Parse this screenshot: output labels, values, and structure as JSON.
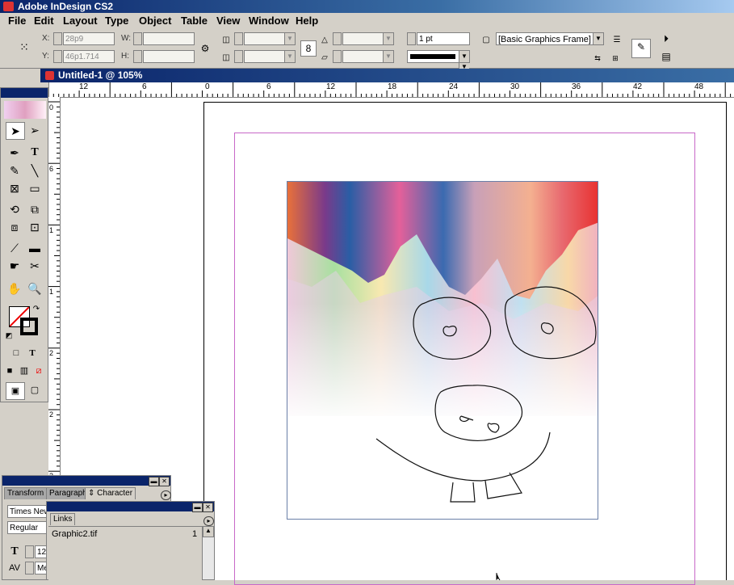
{
  "app": {
    "title": "Adobe InDesign CS2"
  },
  "menu": [
    "File",
    "Edit",
    "Layout",
    "Type",
    "Object",
    "Table",
    "View",
    "Window",
    "Help"
  ],
  "control_panel": {
    "x_label": "X:",
    "x_value": "28p9",
    "y_label": "Y:",
    "y_value": "46p1.714",
    "w_label": "W:",
    "h_label": "H:",
    "stroke_weight": "1 pt",
    "object_style": "[Basic Graphics Frame]"
  },
  "document": {
    "title": "Untitled-1 @ 105%"
  },
  "ruler_h": [
    "12",
    "6",
    "0",
    "6",
    "12",
    "18",
    "24",
    "30",
    "36",
    "42",
    "48"
  ],
  "ruler_v": [
    "0",
    "6",
    "1",
    "1",
    "2",
    "2",
    "3"
  ],
  "character_panel": {
    "tabs": [
      "Transform",
      "Paragraph",
      "Character"
    ],
    "font": "Times New",
    "style": "Regular",
    "size": "12",
    "tracking_value": "Me"
  },
  "links_panel": {
    "tab": "Links",
    "items": [
      {
        "name": "Graphic2.tif",
        "page": "1"
      }
    ]
  }
}
